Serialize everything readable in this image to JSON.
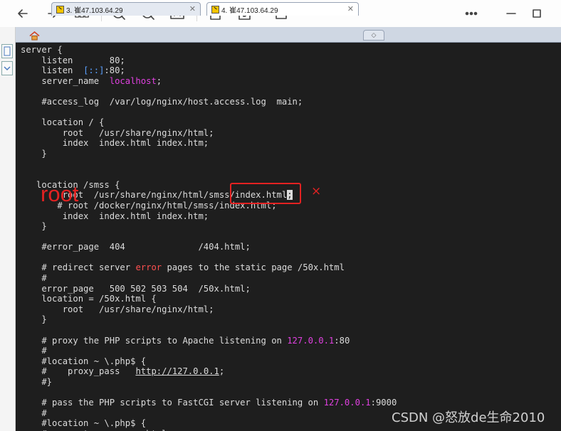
{
  "toolbar": {
    "buttons": [
      "back-icon",
      "forward-icon",
      "grid-icon",
      "zoom-in-icon",
      "zoom-out-icon",
      "actual-size-icon",
      "rotate-icon",
      "edit-icon",
      "download-icon",
      "more-icon",
      "minimize-icon",
      "maximize-icon"
    ]
  },
  "tabs": [
    {
      "label": "3. 崔47.103.64.29",
      "active": false
    },
    {
      "label": "4. 崔47.103.64.29",
      "active": true
    }
  ],
  "terminal": {
    "lines": [
      [
        {
          "t": "server {"
        }
      ],
      [
        {
          "t": "    listen       80;"
        }
      ],
      [
        {
          "t": "    listen  "
        },
        {
          "t": "[::]",
          "c": "kw-blue"
        },
        {
          "t": ":80;"
        }
      ],
      [
        {
          "t": "    server_name  "
        },
        {
          "t": "localhost",
          "c": "kw-mag"
        },
        {
          "t": ";"
        }
      ],
      [
        {
          "t": ""
        }
      ],
      [
        {
          "t": "    #access_log  /var/log/nginx/host.access.log  main;"
        }
      ],
      [
        {
          "t": ""
        }
      ],
      [
        {
          "t": "    location / {"
        }
      ],
      [
        {
          "t": "        root   /usr/share/nginx/html;"
        }
      ],
      [
        {
          "t": "        index  index.html index.htm;"
        }
      ],
      [
        {
          "t": "    }"
        }
      ],
      [
        {
          "t": ""
        }
      ],
      [
        {
          "t": ""
        }
      ],
      [
        {
          "t": "   location /smss {"
        }
      ],
      [
        {
          "t": "        root  /usr/share/nginx/html/smss/index.html"
        },
        {
          "t": ";",
          "c": "cursor"
        }
      ],
      [
        {
          "t": "       # root /docker/nginx/html/smss/index.html;"
        }
      ],
      [
        {
          "t": "        index  index.html index.htm;"
        }
      ],
      [
        {
          "t": "    }"
        }
      ],
      [
        {
          "t": ""
        }
      ],
      [
        {
          "t": "    #error_page  404              /404.html;"
        }
      ],
      [
        {
          "t": ""
        }
      ],
      [
        {
          "t": "    # redirect server "
        },
        {
          "t": "error",
          "c": "kw-red"
        },
        {
          "t": " pages to the static page /50x.html"
        }
      ],
      [
        {
          "t": "    #"
        }
      ],
      [
        {
          "t": "    error_page   500 502 503 504  /50x.html;"
        }
      ],
      [
        {
          "t": "    location = /50x.html {"
        }
      ],
      [
        {
          "t": "        root   /usr/share/nginx/html;"
        }
      ],
      [
        {
          "t": "    }"
        }
      ],
      [
        {
          "t": ""
        }
      ],
      [
        {
          "t": "    # proxy the PHP scripts to Apache listening on "
        },
        {
          "t": "127.0.0.1",
          "c": "kw-mag"
        },
        {
          "t": ":80"
        }
      ],
      [
        {
          "t": "    #"
        }
      ],
      [
        {
          "t": "    #location ~ \\.php$ {"
        }
      ],
      [
        {
          "t": "    #    proxy_pass   "
        },
        {
          "t": "http://127.0.0.1",
          "c": "url"
        },
        {
          "t": ";"
        }
      ],
      [
        {
          "t": "    #}"
        }
      ],
      [
        {
          "t": ""
        }
      ],
      [
        {
          "t": "    # pass the PHP scripts to FastCGI server listening on "
        },
        {
          "t": "127.0.0.1",
          "c": "kw-mag"
        },
        {
          "t": ":9000"
        }
      ],
      [
        {
          "t": "    #"
        }
      ],
      [
        {
          "t": "    #location ~ \\.php$ {"
        }
      ],
      [
        {
          "t": "    #    root           html;"
        }
      ]
    ]
  },
  "annotations": {
    "root_label": "root",
    "x_mark": "×",
    "box_color": "#e32222"
  },
  "watermark": "CSDN @怒放de生命2010",
  "colors": {
    "terminal_bg": "#1e1e1e",
    "terminal_fg": "#dcdcdc",
    "tab_strip": "#cfd7e3"
  }
}
